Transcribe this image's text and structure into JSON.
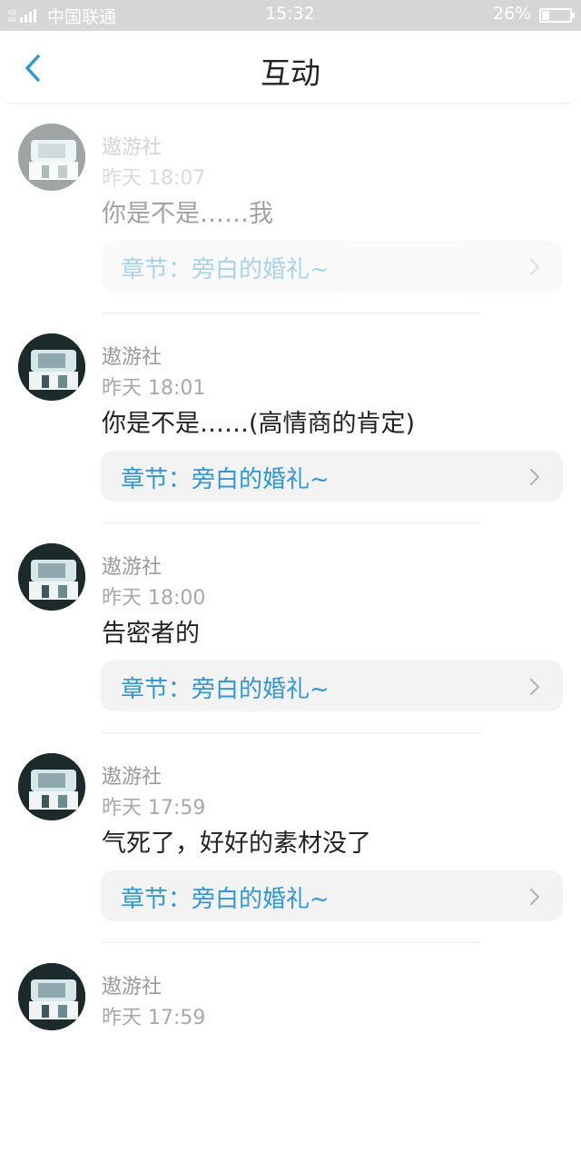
{
  "status_bar": {
    "signal": "4G 4G",
    "carrier": "中国联通",
    "time": "15:32",
    "battery": "26%",
    "battery_level": 0.26
  },
  "header": {
    "title": "互动",
    "back_icon": "chevron-left-icon",
    "accent_color": "#2e97dd"
  },
  "feed": [
    {
      "name": "遨游社",
      "time": "昨天 18:07",
      "content": "你是不是……我",
      "chapter": "章节：旁白的婚礼~",
      "faded": true
    },
    {
      "name": "遨游社",
      "time": "昨天 18:01",
      "content": "你是不是……(高情商的肯定)",
      "chapter": "章节：旁白的婚礼~",
      "faded": false
    },
    {
      "name": "遨游社",
      "time": "昨天 18:00",
      "content": "告密者的",
      "chapter": "章节：旁白的婚礼~",
      "faded": false
    },
    {
      "name": "遨游社",
      "time": "昨天 17:59",
      "content": "气死了，好好的素材没了",
      "chapter": "章节：旁白的婚礼~",
      "faded": false
    },
    {
      "name": "遨游社",
      "time": "昨天 17:59",
      "content": "",
      "chapter": "",
      "faded": false
    }
  ]
}
